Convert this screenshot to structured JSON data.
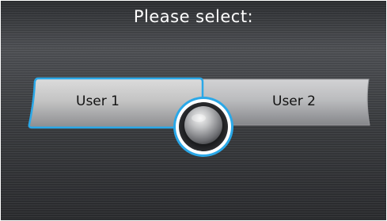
{
  "screen": {
    "title": "Please select:"
  },
  "options": [
    {
      "label": "User 1",
      "selected": true
    },
    {
      "label": "User 2",
      "selected": false
    }
  ],
  "colors": {
    "highlight": "#2aa8e8",
    "text_title": "#ffffff",
    "text_option": "#121212"
  },
  "icons": {
    "selector_knob": "interface-dial-icon"
  }
}
